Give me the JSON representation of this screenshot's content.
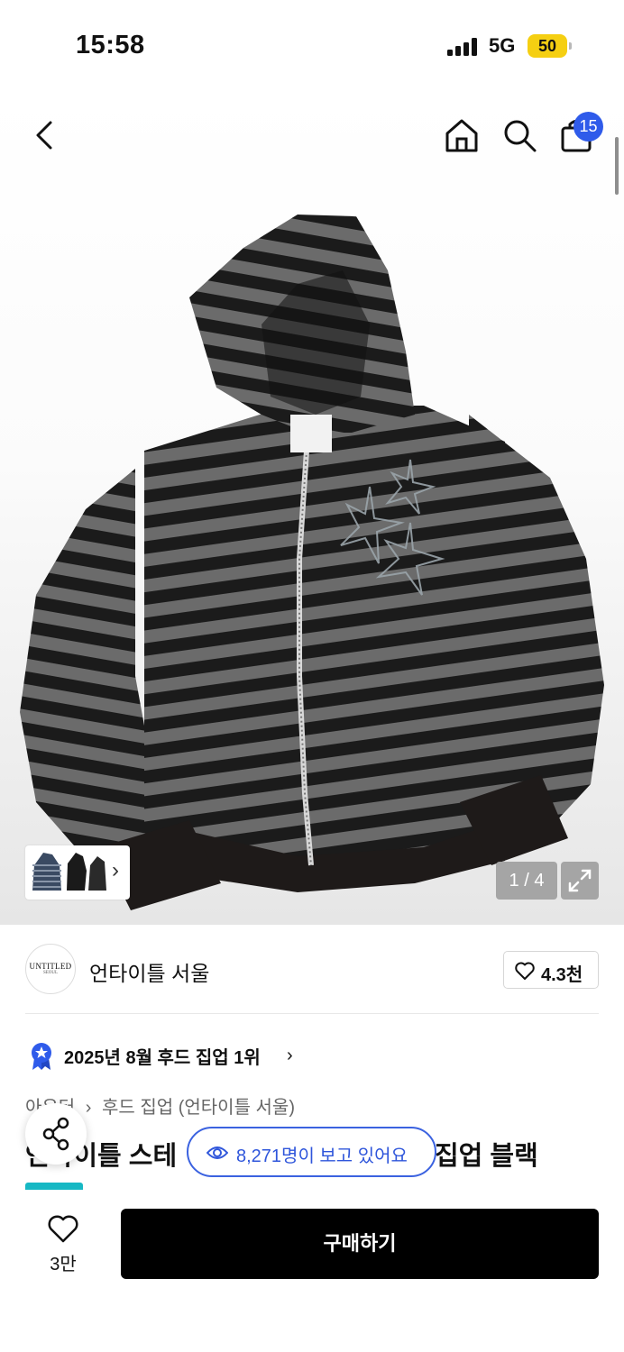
{
  "status_bar": {
    "time": "15:58",
    "network": "5G",
    "battery": "50"
  },
  "header": {
    "cart_count": "15",
    "icons": [
      "back-icon",
      "home-icon",
      "search-icon",
      "shopping-bag-icon"
    ]
  },
  "gallery": {
    "counter": "1 / 4",
    "thumbnail_arrow": "›"
  },
  "brand": {
    "logo_text": "UNTITLED",
    "logo_subtext": "SEOUL",
    "name": "언타이틀 서울",
    "likes": "4.3천"
  },
  "ranking": {
    "text": "2025년 8월 후드 집업 1위",
    "chevron": "›"
  },
  "breadcrumb": {
    "category": "아우터",
    "separator": "›",
    "subcategory": "후드 집업 (언타이틀 서울)"
  },
  "product": {
    "title_visible_left": "언타이틀 스테",
    "title_visible_right": "집업 블랙"
  },
  "viewers": {
    "text": "8,271명이 보고 있어요"
  },
  "bottom_bar": {
    "wish_count": "3만",
    "buy_label": "구매하기"
  },
  "colors": {
    "accent_blue": "#2f5bea",
    "buy_button": "#000000",
    "battery_yellow": "#f5cf12",
    "tag_teal": "#17b8c4"
  }
}
